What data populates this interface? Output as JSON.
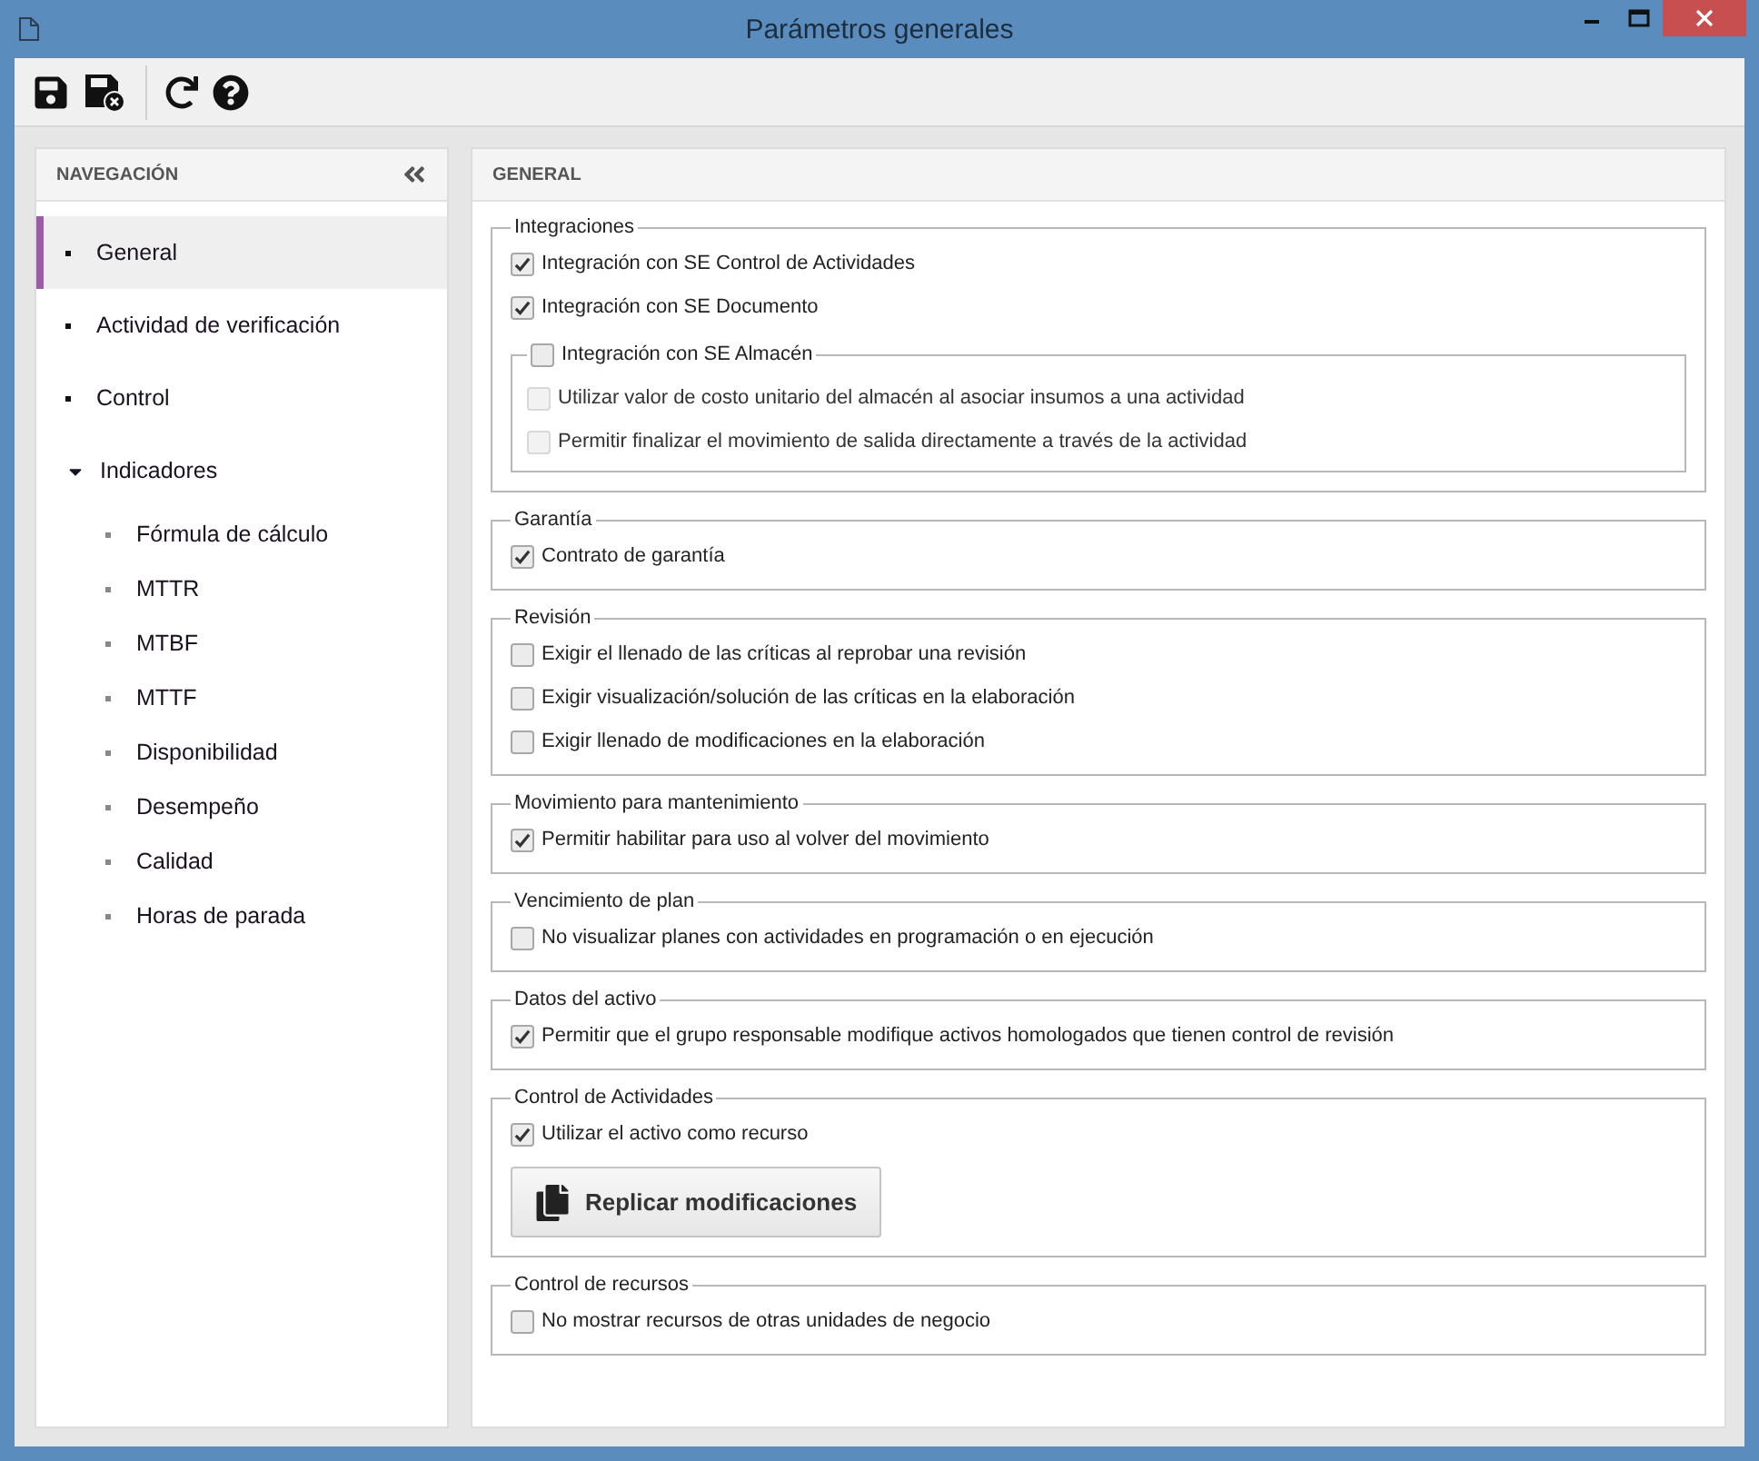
{
  "window": {
    "title": "Parámetros generales"
  },
  "navigation": {
    "title": "NAVEGACIÓN",
    "items": [
      {
        "kind": "leaf",
        "label": "General",
        "selected": true
      },
      {
        "kind": "leaf",
        "label": "Actividad de verificación",
        "selected": false
      },
      {
        "kind": "leaf",
        "label": "Control",
        "selected": false
      },
      {
        "kind": "folder",
        "label": "Indicadores",
        "selected": false,
        "expanded": true,
        "children": [
          {
            "kind": "leaf",
            "label": "Fórmula de cálculo",
            "selected": false
          },
          {
            "kind": "leaf",
            "label": "MTTR",
            "selected": false
          },
          {
            "kind": "leaf",
            "label": "MTBF",
            "selected": false
          },
          {
            "kind": "leaf",
            "label": "MTTF",
            "selected": false
          },
          {
            "kind": "leaf",
            "label": "Disponibilidad",
            "selected": false
          },
          {
            "kind": "leaf",
            "label": "Desempeño",
            "selected": false
          },
          {
            "kind": "leaf",
            "label": "Calidad",
            "selected": false
          },
          {
            "kind": "leaf",
            "label": "Horas de parada",
            "selected": false
          }
        ]
      }
    ]
  },
  "panel": {
    "title": "GENERAL",
    "sections": [
      {
        "legend": "Integraciones",
        "items": [
          {
            "kind": "checkbox",
            "label": "Integración con SE Control de Actividades",
            "checked": true
          },
          {
            "kind": "checkbox",
            "label": "Integración con SE Documento",
            "checked": true
          },
          {
            "kind": "group",
            "legend": {
              "label": "Integración con SE Almacén",
              "checked": false
            },
            "items": [
              {
                "kind": "checkbox",
                "label": "Utilizar valor de costo unitario del almacén al asociar insumos a una actividad",
                "checked": false,
                "disabled": true
              },
              {
                "kind": "checkbox",
                "label": "Permitir finalizar el movimiento de salida directamente a través de la actividad",
                "checked": false,
                "disabled": true
              }
            ]
          }
        ]
      },
      {
        "legend": "Garantía",
        "items": [
          {
            "kind": "checkbox",
            "label": "Contrato de garantía",
            "checked": true
          }
        ]
      },
      {
        "legend": "Revisión",
        "items": [
          {
            "kind": "checkbox",
            "label": "Exigir el llenado de las críticas al reprobar una revisión",
            "checked": false
          },
          {
            "kind": "checkbox",
            "label": "Exigir visualización/solución de las críticas en la elaboración",
            "checked": false
          },
          {
            "kind": "checkbox",
            "label": "Exigir llenado de modificaciones en la elaboración",
            "checked": false
          }
        ]
      },
      {
        "legend": "Movimiento para mantenimiento",
        "items": [
          {
            "kind": "checkbox",
            "label": "Permitir habilitar para uso al volver del movimiento",
            "checked": true
          }
        ]
      },
      {
        "legend": "Vencimiento de plan",
        "items": [
          {
            "kind": "checkbox",
            "label": "No visualizar planes con actividades en programación o en ejecución",
            "checked": false
          }
        ]
      },
      {
        "legend": "Datos del activo",
        "items": [
          {
            "kind": "checkbox",
            "label": "Permitir que el grupo responsable modifique activos homologados que tienen control de revisión",
            "checked": true
          }
        ]
      },
      {
        "legend": "Control de Actividades",
        "items": [
          {
            "kind": "checkbox",
            "label": "Utilizar el activo como recurso",
            "checked": true
          },
          {
            "kind": "button",
            "label": "Replicar modificaciones"
          }
        ]
      },
      {
        "legend": "Control de recursos",
        "items": [
          {
            "kind": "checkbox",
            "label": "No mostrar recursos de otras unidades de negocio",
            "checked": false
          }
        ]
      }
    ]
  }
}
